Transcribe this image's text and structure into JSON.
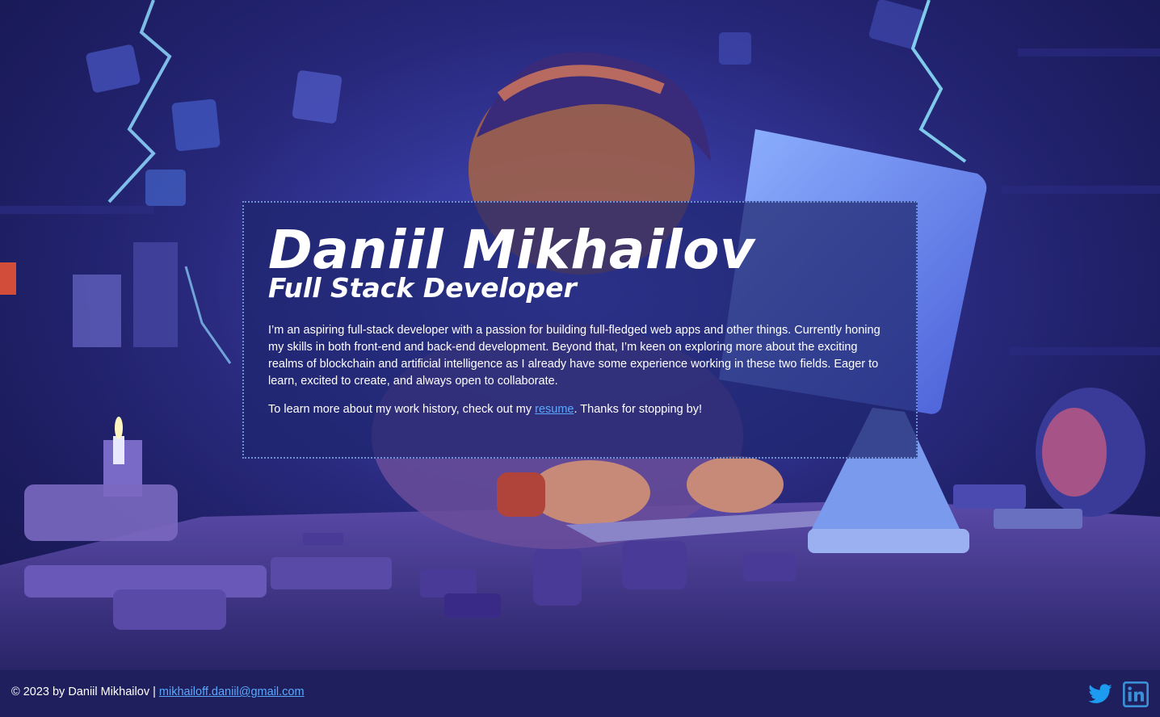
{
  "hero": {
    "name": "Daniil Mikhailov",
    "role": "Full Stack Developer",
    "bio": "I’m an aspiring full-stack developer with a passion for building full-fledged web apps and other things. Currently honing my skills in both front-end and back-end development. Beyond that, I’m keen on exploring more about the exciting realms of blockchain and artificial intelligence as I already have some experience working in these two fields. Eager to learn, excited to create, and always open to collaborate.",
    "cta_before": "To learn more about my work history, check out my ",
    "cta_link": "resume",
    "cta_after": ". Thanks for stopping by!"
  },
  "footer": {
    "copyright": "© 2023 by Daniil Mikhailov | ",
    "email": "mikhailoff.daniil@gmail.com",
    "icons": [
      "twitter-icon",
      "linkedin-icon"
    ]
  },
  "colors": {
    "link": "#5aa9ff",
    "footer_bg": "#1e1f5c",
    "card_border": "#6f8fd6",
    "twitter": "#1d9bf0",
    "linkedin": "#3b8fd6"
  }
}
